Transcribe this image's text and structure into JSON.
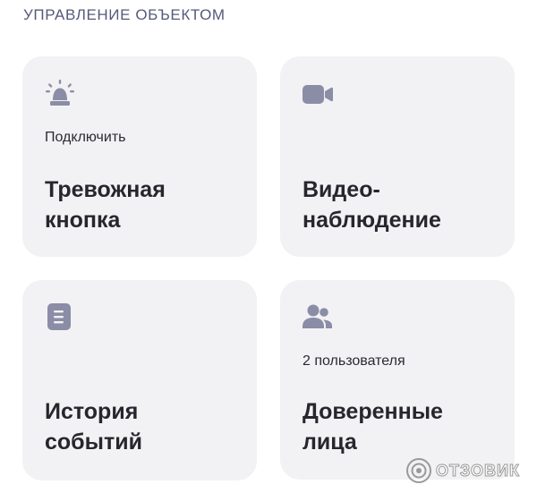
{
  "section": {
    "title": "УПРАВЛЕНИЕ ОБЪЕКТОМ"
  },
  "cards": [
    {
      "icon": "alarm-siren-icon",
      "subtitle": "Подключить",
      "title_line1": "Тревожная",
      "title_line2": "кнопка"
    },
    {
      "icon": "video-camera-icon",
      "subtitle": "",
      "title_line1": "Видео-",
      "title_line2": "наблюдение"
    },
    {
      "icon": "document-icon",
      "subtitle": "",
      "title_line1": "История",
      "title_line2": "событий"
    },
    {
      "icon": "users-icon",
      "subtitle": "2 пользователя",
      "title_line1": "Доверенные",
      "title_line2": "лица"
    }
  ],
  "watermark": {
    "text": "ОТЗОВИК"
  },
  "colors": {
    "card_background": "#f2f2f4",
    "icon": "#8b8da6",
    "title": "#26262d",
    "section_title": "#56597a"
  }
}
